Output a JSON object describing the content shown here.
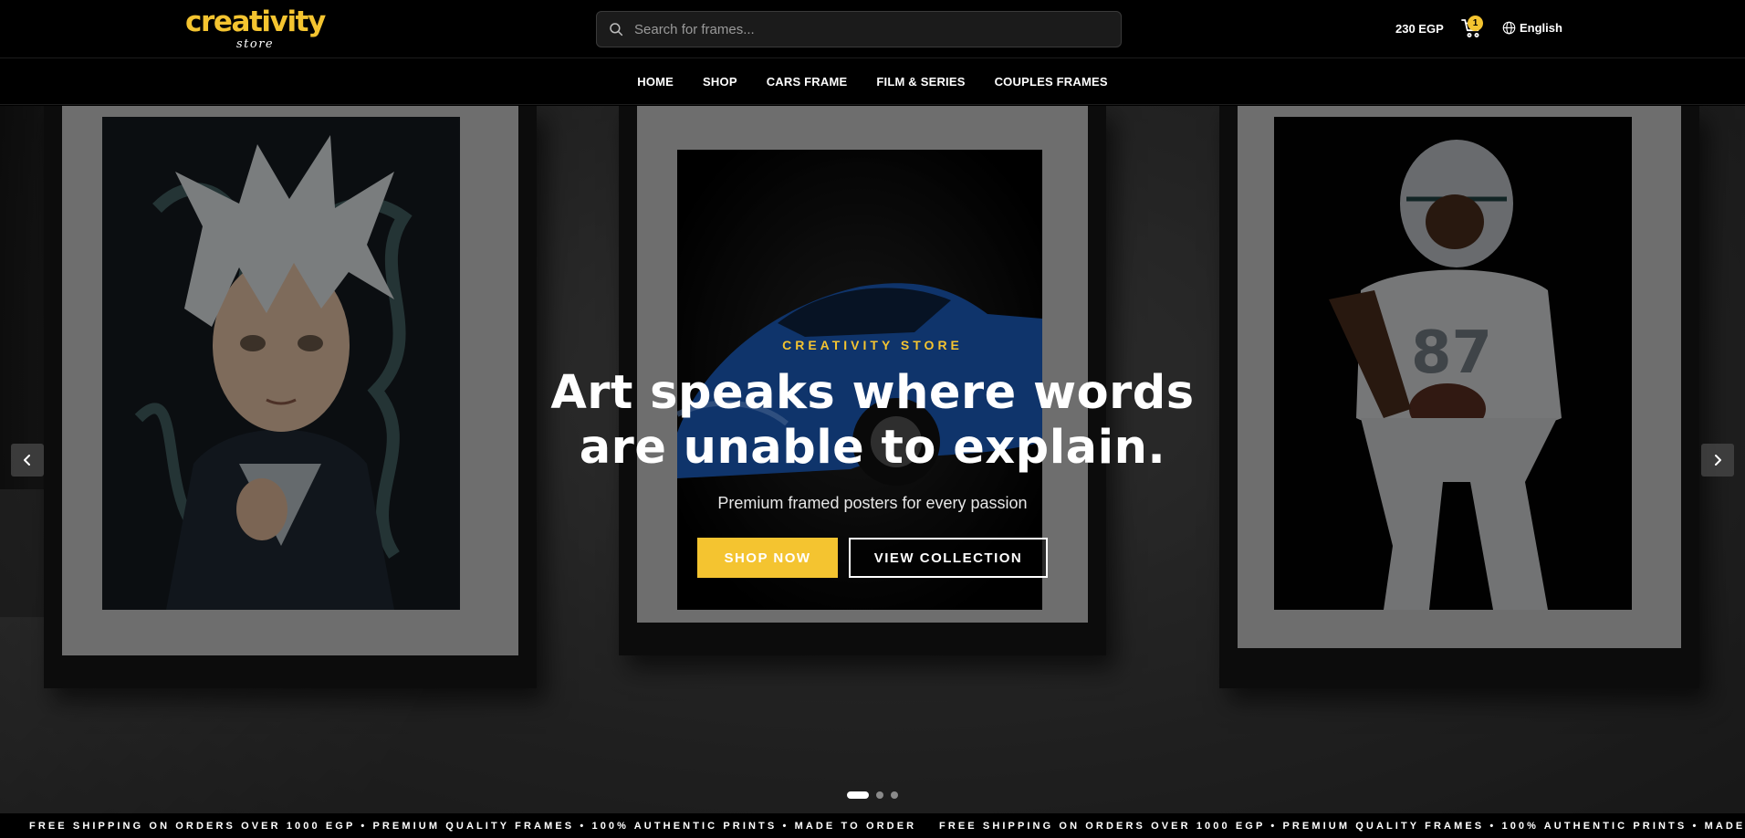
{
  "brand": {
    "name": "creativity",
    "tagline": "store",
    "accent_color": "#f4c430"
  },
  "header": {
    "search_placeholder": "Search for frames...",
    "search_icon": "search-icon",
    "cart_total": "230 EGP",
    "cart_icon": "cart-icon",
    "cart_count": "1",
    "language_icon": "globe-icon",
    "language": "English"
  },
  "nav": {
    "items": [
      {
        "label": "HOME"
      },
      {
        "label": "SHOP"
      },
      {
        "label": "CARS FRAME"
      },
      {
        "label": "FILM & SERIES"
      },
      {
        "label": "COUPLES FRAMES"
      }
    ]
  },
  "hero": {
    "eyebrow": "CREATIVITY STORE",
    "headline_line1": "Art speaks where words",
    "headline_line2": "are unable to explain.",
    "subheadline": "Premium framed posters for every passion",
    "primary_cta": "SHOP NOW",
    "secondary_cta": "VIEW COLLECTION",
    "prev_icon": "chevron-left-icon",
    "next_icon": "chevron-right-icon",
    "slides_total": 3,
    "active_slide": 1,
    "framed_posters": [
      "anime character portrait",
      "blue sports car",
      "football player"
    ]
  },
  "ticker": {
    "text": "FREE SHIPPING ON ORDERS OVER 1000 EGP  •  PREMIUM QUALITY FRAMES  •  100% AUTHENTIC PRINTS  •  MADE TO ORDER"
  }
}
